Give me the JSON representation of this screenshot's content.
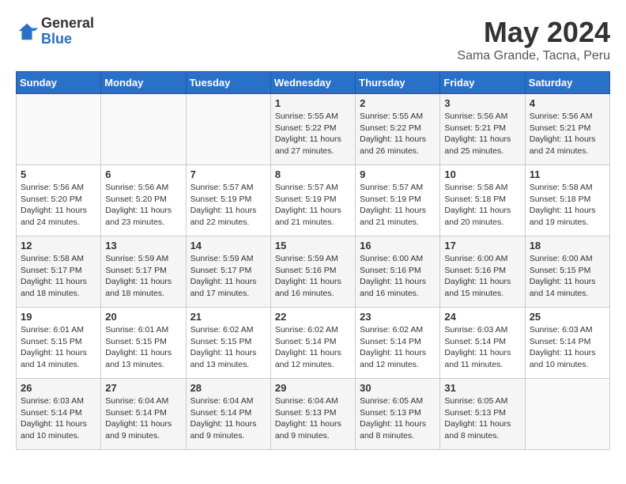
{
  "logo": {
    "general": "General",
    "blue": "Blue"
  },
  "title": {
    "month_year": "May 2024",
    "location": "Sama Grande, Tacna, Peru"
  },
  "days_of_week": [
    "Sunday",
    "Monday",
    "Tuesday",
    "Wednesday",
    "Thursday",
    "Friday",
    "Saturday"
  ],
  "weeks": [
    [
      {
        "day": "",
        "sunrise": "",
        "sunset": "",
        "daylight": ""
      },
      {
        "day": "",
        "sunrise": "",
        "sunset": "",
        "daylight": ""
      },
      {
        "day": "",
        "sunrise": "",
        "sunset": "",
        "daylight": ""
      },
      {
        "day": "1",
        "sunrise": "Sunrise: 5:55 AM",
        "sunset": "Sunset: 5:22 PM",
        "daylight": "Daylight: 11 hours and 27 minutes."
      },
      {
        "day": "2",
        "sunrise": "Sunrise: 5:55 AM",
        "sunset": "Sunset: 5:22 PM",
        "daylight": "Daylight: 11 hours and 26 minutes."
      },
      {
        "day": "3",
        "sunrise": "Sunrise: 5:56 AM",
        "sunset": "Sunset: 5:21 PM",
        "daylight": "Daylight: 11 hours and 25 minutes."
      },
      {
        "day": "4",
        "sunrise": "Sunrise: 5:56 AM",
        "sunset": "Sunset: 5:21 PM",
        "daylight": "Daylight: 11 hours and 24 minutes."
      }
    ],
    [
      {
        "day": "5",
        "sunrise": "Sunrise: 5:56 AM",
        "sunset": "Sunset: 5:20 PM",
        "daylight": "Daylight: 11 hours and 24 minutes."
      },
      {
        "day": "6",
        "sunrise": "Sunrise: 5:56 AM",
        "sunset": "Sunset: 5:20 PM",
        "daylight": "Daylight: 11 hours and 23 minutes."
      },
      {
        "day": "7",
        "sunrise": "Sunrise: 5:57 AM",
        "sunset": "Sunset: 5:19 PM",
        "daylight": "Daylight: 11 hours and 22 minutes."
      },
      {
        "day": "8",
        "sunrise": "Sunrise: 5:57 AM",
        "sunset": "Sunset: 5:19 PM",
        "daylight": "Daylight: 11 hours and 21 minutes."
      },
      {
        "day": "9",
        "sunrise": "Sunrise: 5:57 AM",
        "sunset": "Sunset: 5:19 PM",
        "daylight": "Daylight: 11 hours and 21 minutes."
      },
      {
        "day": "10",
        "sunrise": "Sunrise: 5:58 AM",
        "sunset": "Sunset: 5:18 PM",
        "daylight": "Daylight: 11 hours and 20 minutes."
      },
      {
        "day": "11",
        "sunrise": "Sunrise: 5:58 AM",
        "sunset": "Sunset: 5:18 PM",
        "daylight": "Daylight: 11 hours and 19 minutes."
      }
    ],
    [
      {
        "day": "12",
        "sunrise": "Sunrise: 5:58 AM",
        "sunset": "Sunset: 5:17 PM",
        "daylight": "Daylight: 11 hours and 18 minutes."
      },
      {
        "day": "13",
        "sunrise": "Sunrise: 5:59 AM",
        "sunset": "Sunset: 5:17 PM",
        "daylight": "Daylight: 11 hours and 18 minutes."
      },
      {
        "day": "14",
        "sunrise": "Sunrise: 5:59 AM",
        "sunset": "Sunset: 5:17 PM",
        "daylight": "Daylight: 11 hours and 17 minutes."
      },
      {
        "day": "15",
        "sunrise": "Sunrise: 5:59 AM",
        "sunset": "Sunset: 5:16 PM",
        "daylight": "Daylight: 11 hours and 16 minutes."
      },
      {
        "day": "16",
        "sunrise": "Sunrise: 6:00 AM",
        "sunset": "Sunset: 5:16 PM",
        "daylight": "Daylight: 11 hours and 16 minutes."
      },
      {
        "day": "17",
        "sunrise": "Sunrise: 6:00 AM",
        "sunset": "Sunset: 5:16 PM",
        "daylight": "Daylight: 11 hours and 15 minutes."
      },
      {
        "day": "18",
        "sunrise": "Sunrise: 6:00 AM",
        "sunset": "Sunset: 5:15 PM",
        "daylight": "Daylight: 11 hours and 14 minutes."
      }
    ],
    [
      {
        "day": "19",
        "sunrise": "Sunrise: 6:01 AM",
        "sunset": "Sunset: 5:15 PM",
        "daylight": "Daylight: 11 hours and 14 minutes."
      },
      {
        "day": "20",
        "sunrise": "Sunrise: 6:01 AM",
        "sunset": "Sunset: 5:15 PM",
        "daylight": "Daylight: 11 hours and 13 minutes."
      },
      {
        "day": "21",
        "sunrise": "Sunrise: 6:02 AM",
        "sunset": "Sunset: 5:15 PM",
        "daylight": "Daylight: 11 hours and 13 minutes."
      },
      {
        "day": "22",
        "sunrise": "Sunrise: 6:02 AM",
        "sunset": "Sunset: 5:14 PM",
        "daylight": "Daylight: 11 hours and 12 minutes."
      },
      {
        "day": "23",
        "sunrise": "Sunrise: 6:02 AM",
        "sunset": "Sunset: 5:14 PM",
        "daylight": "Daylight: 11 hours and 12 minutes."
      },
      {
        "day": "24",
        "sunrise": "Sunrise: 6:03 AM",
        "sunset": "Sunset: 5:14 PM",
        "daylight": "Daylight: 11 hours and 11 minutes."
      },
      {
        "day": "25",
        "sunrise": "Sunrise: 6:03 AM",
        "sunset": "Sunset: 5:14 PM",
        "daylight": "Daylight: 11 hours and 10 minutes."
      }
    ],
    [
      {
        "day": "26",
        "sunrise": "Sunrise: 6:03 AM",
        "sunset": "Sunset: 5:14 PM",
        "daylight": "Daylight: 11 hours and 10 minutes."
      },
      {
        "day": "27",
        "sunrise": "Sunrise: 6:04 AM",
        "sunset": "Sunset: 5:14 PM",
        "daylight": "Daylight: 11 hours and 9 minutes."
      },
      {
        "day": "28",
        "sunrise": "Sunrise: 6:04 AM",
        "sunset": "Sunset: 5:14 PM",
        "daylight": "Daylight: 11 hours and 9 minutes."
      },
      {
        "day": "29",
        "sunrise": "Sunrise: 6:04 AM",
        "sunset": "Sunset: 5:13 PM",
        "daylight": "Daylight: 11 hours and 9 minutes."
      },
      {
        "day": "30",
        "sunrise": "Sunrise: 6:05 AM",
        "sunset": "Sunset: 5:13 PM",
        "daylight": "Daylight: 11 hours and 8 minutes."
      },
      {
        "day": "31",
        "sunrise": "Sunrise: 6:05 AM",
        "sunset": "Sunset: 5:13 PM",
        "daylight": "Daylight: 11 hours and 8 minutes."
      },
      {
        "day": "",
        "sunrise": "",
        "sunset": "",
        "daylight": ""
      }
    ]
  ]
}
